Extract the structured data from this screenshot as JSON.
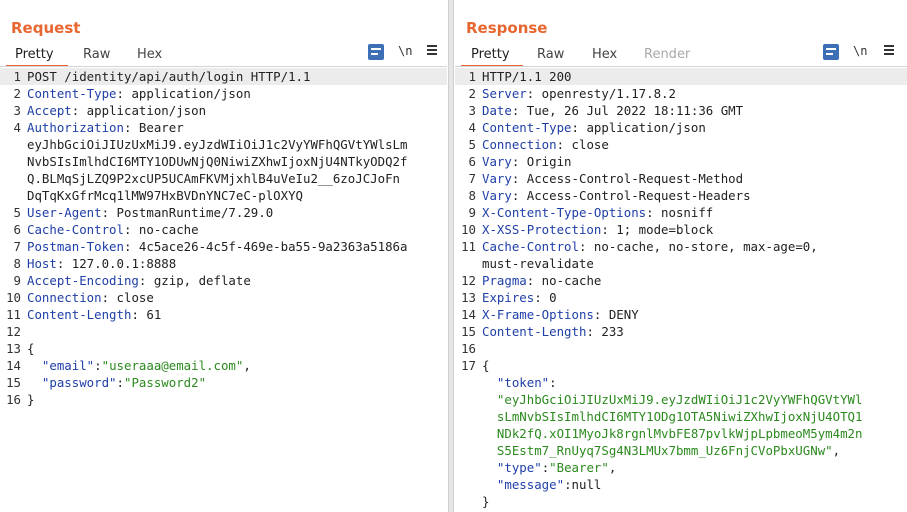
{
  "request": {
    "title": "Request",
    "tabs": [
      "Pretty",
      "Raw",
      "Hex"
    ],
    "tools": {
      "wrap_icon": "wrap-icon",
      "newline_label": "\\n",
      "menu_icon": "hamburger-menu-icon"
    },
    "lines": [
      {
        "n": "1",
        "parts": [
          {
            "t": "POST /identity/api/auth/login HTTP/1.1",
            "c": ""
          }
        ]
      },
      {
        "n": "2",
        "parts": [
          {
            "t": "Content-Type",
            "c": "k"
          },
          {
            "t": ": application/json",
            "c": ""
          }
        ]
      },
      {
        "n": "3",
        "parts": [
          {
            "t": "Accept",
            "c": "k"
          },
          {
            "t": ": application/json",
            "c": ""
          }
        ]
      },
      {
        "n": "4",
        "parts": [
          {
            "t": "Authorization",
            "c": "k"
          },
          {
            "t": ": Bearer",
            "c": ""
          }
        ]
      },
      {
        "n": "",
        "parts": [
          {
            "t": "eyJhbGciOiJIUzUxMiJ9.eyJzdWIiOiJ1c2VyYWFhQGVtYWlsLm",
            "c": ""
          }
        ]
      },
      {
        "n": "",
        "parts": [
          {
            "t": "NvbSIsImlhdCI6MTY1ODUwNjQ0NiwiZXhwIjoxNjU4NTkyODQ2f",
            "c": ""
          }
        ]
      },
      {
        "n": "",
        "parts": [
          {
            "t": "Q.BLMqSjLZQ9P2xcUP5UCAmFKVMjxhlB4uVeIu2__6zoJCJoFn",
            "c": ""
          }
        ]
      },
      {
        "n": "",
        "parts": [
          {
            "t": "DqTqKxGfrMcq1lMW97HxBVDnYNC7eC-plOXYQ",
            "c": ""
          }
        ]
      },
      {
        "n": "5",
        "parts": [
          {
            "t": "User-Agent",
            "c": "k"
          },
          {
            "t": ": PostmanRuntime/7.29.0",
            "c": ""
          }
        ]
      },
      {
        "n": "6",
        "parts": [
          {
            "t": "Cache-Control",
            "c": "k"
          },
          {
            "t": ": no-cache",
            "c": ""
          }
        ]
      },
      {
        "n": "7",
        "parts": [
          {
            "t": "Postman-Token",
            "c": "k"
          },
          {
            "t": ": 4c5ace26-4c5f-469e-ba55-9a2363a5186a",
            "c": ""
          }
        ]
      },
      {
        "n": "8",
        "parts": [
          {
            "t": "Host",
            "c": "k"
          },
          {
            "t": ": 127.0.0.1:8888",
            "c": ""
          }
        ]
      },
      {
        "n": "9",
        "parts": [
          {
            "t": "Accept-Encoding",
            "c": "k"
          },
          {
            "t": ": gzip, deflate",
            "c": ""
          }
        ]
      },
      {
        "n": "10",
        "parts": [
          {
            "t": "Connection",
            "c": "k"
          },
          {
            "t": ": close",
            "c": ""
          }
        ]
      },
      {
        "n": "11",
        "parts": [
          {
            "t": "Content-Length",
            "c": "k"
          },
          {
            "t": ": 61",
            "c": ""
          }
        ]
      },
      {
        "n": "12",
        "parts": [
          {
            "t": "",
            "c": ""
          }
        ]
      },
      {
        "n": "13",
        "parts": [
          {
            "t": "{",
            "c": ""
          }
        ]
      },
      {
        "n": "14",
        "parts": [
          {
            "t": "  \"email\"",
            "c": "k"
          },
          {
            "t": ":",
            "c": ""
          },
          {
            "t": "\"useraaa@email.com\"",
            "c": "s"
          },
          {
            "t": ",",
            "c": ""
          }
        ]
      },
      {
        "n": "15",
        "parts": [
          {
            "t": "  \"password\"",
            "c": "k"
          },
          {
            "t": ":",
            "c": ""
          },
          {
            "t": "\"Password2\"",
            "c": "s"
          }
        ]
      },
      {
        "n": "16",
        "parts": [
          {
            "t": "}",
            "c": ""
          }
        ]
      }
    ]
  },
  "response": {
    "title": "Response",
    "tabs": [
      "Pretty",
      "Raw",
      "Hex",
      "Render"
    ],
    "tools": {
      "wrap_icon": "wrap-icon",
      "newline_label": "\\n",
      "menu_icon": "hamburger-menu-icon"
    },
    "lines": [
      {
        "n": "1",
        "parts": [
          {
            "t": "HTTP/1.1 200",
            "c": ""
          }
        ]
      },
      {
        "n": "2",
        "parts": [
          {
            "t": "Server",
            "c": "k"
          },
          {
            "t": ": openresty/1.17.8.2",
            "c": ""
          }
        ]
      },
      {
        "n": "3",
        "parts": [
          {
            "t": "Date",
            "c": "k"
          },
          {
            "t": ": Tue, 26 Jul 2022 18:11:36 GMT",
            "c": ""
          }
        ]
      },
      {
        "n": "4",
        "parts": [
          {
            "t": "Content-Type",
            "c": "k"
          },
          {
            "t": ": application/json",
            "c": ""
          }
        ]
      },
      {
        "n": "5",
        "parts": [
          {
            "t": "Connection",
            "c": "k"
          },
          {
            "t": ": close",
            "c": ""
          }
        ]
      },
      {
        "n": "6",
        "parts": [
          {
            "t": "Vary",
            "c": "k"
          },
          {
            "t": ": Origin",
            "c": ""
          }
        ]
      },
      {
        "n": "7",
        "parts": [
          {
            "t": "Vary",
            "c": "k"
          },
          {
            "t": ": Access-Control-Request-Method",
            "c": ""
          }
        ]
      },
      {
        "n": "8",
        "parts": [
          {
            "t": "Vary",
            "c": "k"
          },
          {
            "t": ": Access-Control-Request-Headers",
            "c": ""
          }
        ]
      },
      {
        "n": "9",
        "parts": [
          {
            "t": "X-Content-Type-Options",
            "c": "k"
          },
          {
            "t": ": nosniff",
            "c": ""
          }
        ]
      },
      {
        "n": "10",
        "parts": [
          {
            "t": "X-XSS-Protection",
            "c": "k"
          },
          {
            "t": ": 1; mode=block",
            "c": ""
          }
        ]
      },
      {
        "n": "11",
        "parts": [
          {
            "t": "Cache-Control",
            "c": "k"
          },
          {
            "t": ": no-cache, no-store, max-age=0,",
            "c": ""
          }
        ]
      },
      {
        "n": "",
        "parts": [
          {
            "t": "must-revalidate",
            "c": ""
          }
        ]
      },
      {
        "n": "12",
        "parts": [
          {
            "t": "Pragma",
            "c": "k"
          },
          {
            "t": ": no-cache",
            "c": ""
          }
        ]
      },
      {
        "n": "13",
        "parts": [
          {
            "t": "Expires",
            "c": "k"
          },
          {
            "t": ": 0",
            "c": ""
          }
        ]
      },
      {
        "n": "14",
        "parts": [
          {
            "t": "X-Frame-Options",
            "c": "k"
          },
          {
            "t": ": DENY",
            "c": ""
          }
        ]
      },
      {
        "n": "15",
        "parts": [
          {
            "t": "Content-Length",
            "c": "k"
          },
          {
            "t": ": 233",
            "c": ""
          }
        ]
      },
      {
        "n": "16",
        "parts": [
          {
            "t": "",
            "c": ""
          }
        ]
      },
      {
        "n": "17",
        "parts": [
          {
            "t": "{",
            "c": ""
          }
        ]
      },
      {
        "n": "",
        "parts": [
          {
            "t": "  \"token\"",
            "c": "k"
          },
          {
            "t": ":",
            "c": ""
          }
        ]
      },
      {
        "n": "",
        "parts": [
          {
            "t": "  \"eyJhbGciOiJIUzUxMiJ9.eyJzdWIiOiJ1c2VyYWFhQGVtYWl",
            "c": "s"
          }
        ]
      },
      {
        "n": "",
        "parts": [
          {
            "t": "  sLmNvbSIsImlhdCI6MTY1ODg1OTA5NiwiZXhwIjoxNjU4OTQ1",
            "c": "s"
          }
        ]
      },
      {
        "n": "",
        "parts": [
          {
            "t": "  NDk2fQ.xOI1MyoJk8rgnlMvbFE87pvlkWjpLpbmeoM5ym4m2n",
            "c": "s"
          }
        ]
      },
      {
        "n": "",
        "parts": [
          {
            "t": "  S5Estm7_RnUyq7Sg4N3LMUx7bmm_Uz6FnjCVoPbxUGNw\"",
            "c": "s"
          },
          {
            "t": ",",
            "c": ""
          }
        ]
      },
      {
        "n": "",
        "parts": [
          {
            "t": "  \"type\"",
            "c": "k"
          },
          {
            "t": ":",
            "c": ""
          },
          {
            "t": "\"Bearer\"",
            "c": "s"
          },
          {
            "t": ",",
            "c": ""
          }
        ]
      },
      {
        "n": "",
        "parts": [
          {
            "t": "  \"message\"",
            "c": "k"
          },
          {
            "t": ":null",
            "c": ""
          }
        ]
      },
      {
        "n": "",
        "parts": [
          {
            "t": "}",
            "c": ""
          }
        ]
      }
    ]
  },
  "layout_toggles": [
    "split-horizontal-icon",
    "split-vertical-icon",
    "single-panel-icon"
  ],
  "colors": {
    "accent": "#e8662f",
    "key": "#1f3fa8",
    "string": "#2c8a1f",
    "button": "#3d6fb6"
  }
}
